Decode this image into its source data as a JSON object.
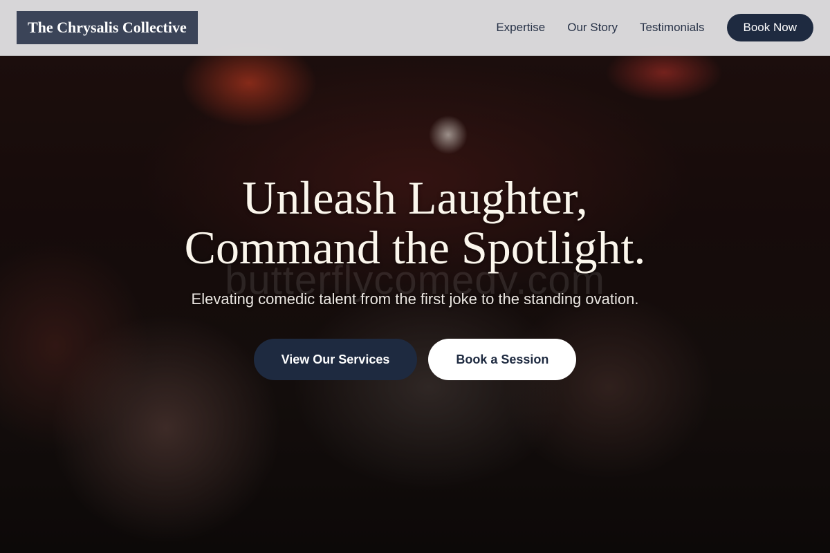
{
  "header": {
    "brand": "The Chrysalis Collective",
    "nav": [
      {
        "label": "Expertise"
      },
      {
        "label": "Our Story"
      },
      {
        "label": "Testimonials"
      }
    ],
    "book_label": "Book Now"
  },
  "hero": {
    "title_line1": "Unleash Laughter,",
    "title_line2": "Command the Spotlight.",
    "subtitle": "Elevating comedic talent from the first joke to the standing ovation.",
    "watermark": "butterflycomedy.com",
    "primary_cta": "View Our Services",
    "secondary_cta": "Book a Session"
  },
  "colors": {
    "brand_navy": "#1e2a40",
    "logo_bg": "#3b4458",
    "header_bg": "#e2e2e4",
    "title_text": "#fbf6ec"
  }
}
